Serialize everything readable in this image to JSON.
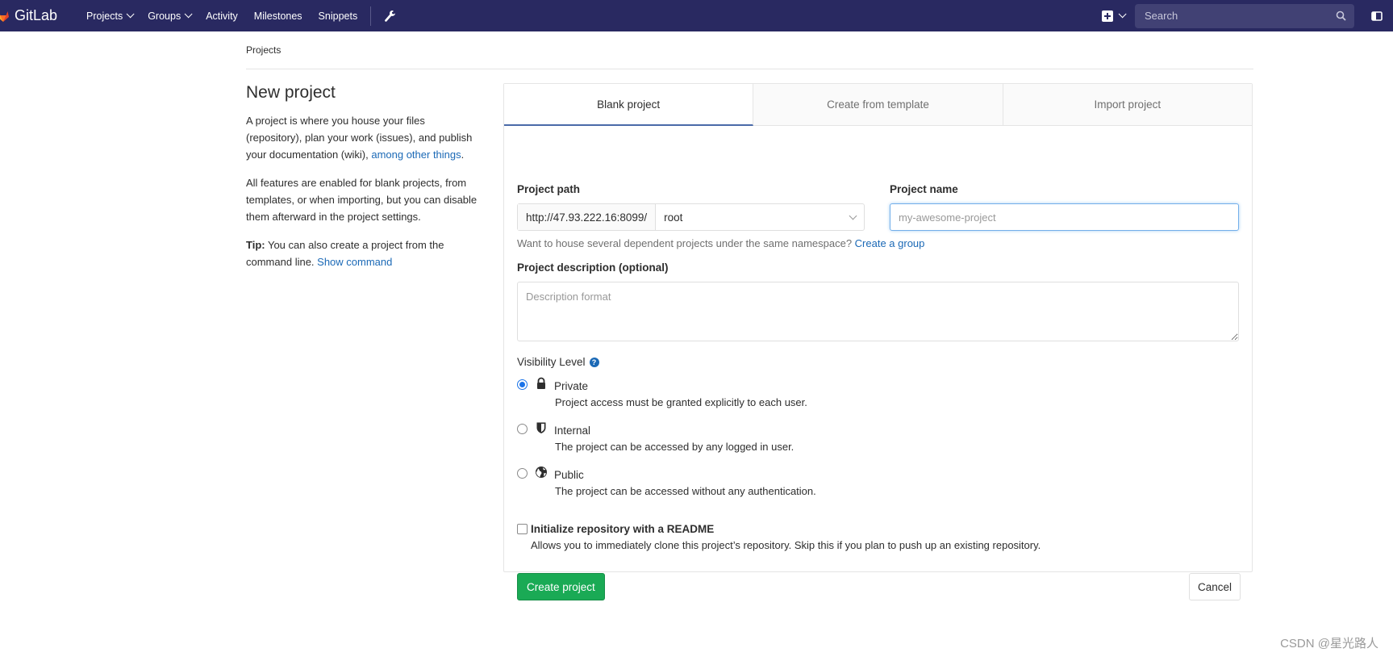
{
  "navbar": {
    "brand": "GitLab",
    "links": [
      {
        "label": "Projects",
        "dropdown": true
      },
      {
        "label": "Groups",
        "dropdown": true
      },
      {
        "label": "Activity",
        "dropdown": false
      },
      {
        "label": "Milestones",
        "dropdown": false
      },
      {
        "label": "Snippets",
        "dropdown": false
      }
    ],
    "search_placeholder": "Search",
    "bg_color": "#292961"
  },
  "breadcrumb": "Projects",
  "left": {
    "title": "New project",
    "intro_text": "A project is where you house your files (repository), plan your work (issues), and publish your documentation (wiki), ",
    "intro_link": "among other things",
    "intro_end": ".",
    "features_text": "All features are enabled for blank projects, from templates, or when importing, but you can disable them afterward in the project settings.",
    "tip_label": "Tip:",
    "tip_text": " You can also create a project from the command line. ",
    "tip_link": "Show command"
  },
  "tabs": [
    {
      "label": "Blank project",
      "active": true
    },
    {
      "label": "Create from template",
      "active": false
    },
    {
      "label": "Import project",
      "active": false
    }
  ],
  "form": {
    "project_path_label": "Project path",
    "path_prefix": "http://47.93.222.16:8099/",
    "namespace_value": "root",
    "project_name_label": "Project name",
    "project_name_placeholder": "my-awesome-project",
    "hint_text": "Want to house several dependent projects under the same namespace? ",
    "hint_link": "Create a group",
    "description_label": "Project description (optional)",
    "description_placeholder": "Description format",
    "visibility_label": "Visibility Level",
    "visibility_options": [
      {
        "title": "Private",
        "desc": "Project access must be granted explicitly to each user.",
        "checked": true,
        "icon": "lock-icon"
      },
      {
        "title": "Internal",
        "desc": "The project can be accessed by any logged in user.",
        "checked": false,
        "icon": "shield-icon"
      },
      {
        "title": "Public",
        "desc": "The project can be accessed without any authentication.",
        "checked": false,
        "icon": "globe-icon"
      }
    ],
    "readme_label": "Initialize repository with a README",
    "readme_help": "Allows you to immediately clone this project’s repository. Skip this if you plan to push up an existing repository.",
    "readme_checked": false,
    "create_button": "Create project",
    "cancel_button": "Cancel",
    "create_color": "#1aaa55"
  },
  "watermark": "CSDN @星光路人"
}
